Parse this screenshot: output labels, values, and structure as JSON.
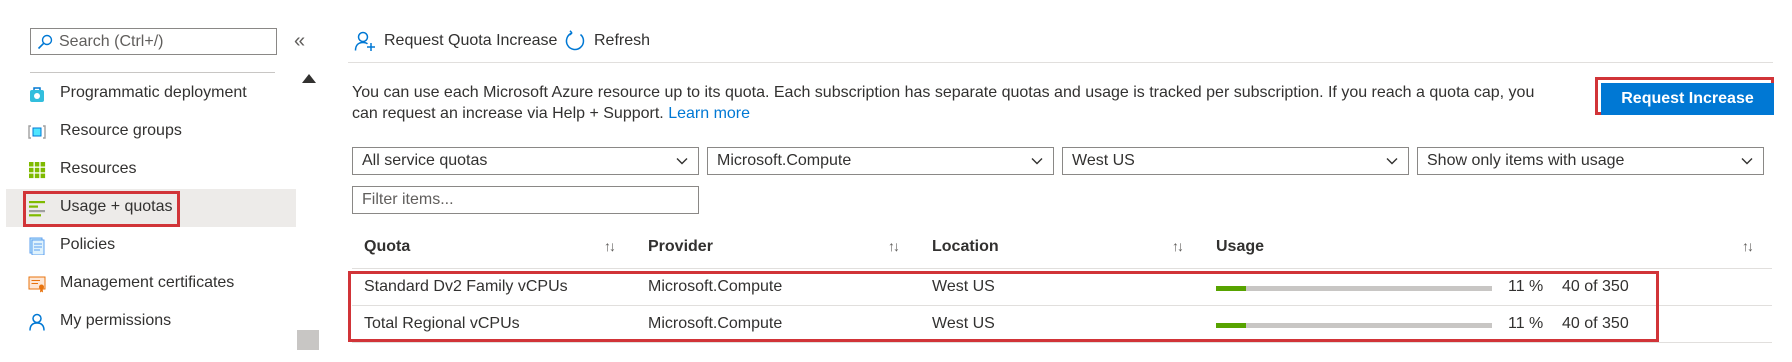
{
  "sidebar": {
    "search_placeholder": "Search (Ctrl+/)",
    "collapse_glyph": "«",
    "items": [
      {
        "label": "Programmatic deployment",
        "icon": "bag-icon",
        "selected": false
      },
      {
        "label": "Resource groups",
        "icon": "cube-icon",
        "selected": false
      },
      {
        "label": "Resources",
        "icon": "grid-icon",
        "selected": false
      },
      {
        "label": "Usage + quotas",
        "icon": "usage-list-icon",
        "selected": true
      },
      {
        "label": "Policies",
        "icon": "document-icon",
        "selected": false
      },
      {
        "label": "Management certificates",
        "icon": "certificate-icon",
        "selected": false
      },
      {
        "label": "My permissions",
        "icon": "person-icon",
        "selected": false
      }
    ]
  },
  "toolbar": {
    "request_quota_label": "Request Quota Increase",
    "refresh_label": "Refresh"
  },
  "description": {
    "text": "You can use each Microsoft Azure resource up to its quota. Each subscription has separate quotas and usage is tracked per subscription. If you reach a quota cap, you can request an increase via Help + Support.",
    "link": "Learn more"
  },
  "request_increase_label": "Request Increase",
  "filters": {
    "service": "All service quotas",
    "provider": "Microsoft.Compute",
    "location": "West US",
    "show": "Show only items with usage",
    "filter_placeholder": "Filter items..."
  },
  "table": {
    "headers": {
      "quota": "Quota",
      "provider": "Provider",
      "location": "Location",
      "usage": "Usage"
    },
    "rows": [
      {
        "quota": "Standard Dv2 Family vCPUs",
        "provider": "Microsoft.Compute",
        "location": "West US",
        "usage_fraction": 0.11,
        "percent": "11 %",
        "count": "40 of 350"
      },
      {
        "quota": "Total Regional vCPUs",
        "provider": "Microsoft.Compute",
        "location": "West US",
        "usage_fraction": 0.11,
        "percent": "11 %",
        "count": "40 of 350"
      }
    ]
  },
  "colors": {
    "accent": "#0078d4",
    "highlight": "#d13438",
    "usage_bar": "#57a300"
  }
}
